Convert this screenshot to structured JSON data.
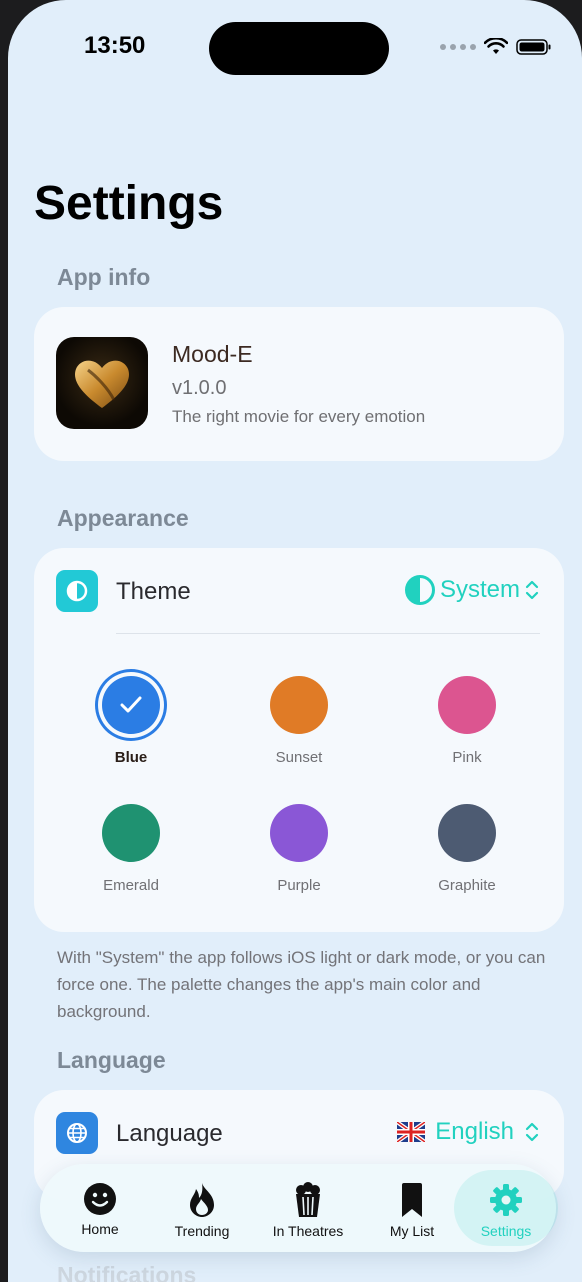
{
  "status": {
    "time": "13:50"
  },
  "page": {
    "title": "Settings"
  },
  "sections": {
    "app_info": "App info",
    "appearance": "Appearance",
    "language": "Language",
    "notifications": "Notifications"
  },
  "app": {
    "name": "Mood-E",
    "version": "v1.0.0",
    "tagline": "The right movie for every emotion"
  },
  "theme": {
    "label": "Theme",
    "value": "System",
    "accent": "#21d1bf",
    "icon": "half-circle-icon"
  },
  "palettes": [
    {
      "name": "Blue",
      "color": "#2b7de4",
      "selected": true
    },
    {
      "name": "Sunset",
      "color": "#e07b26",
      "selected": false
    },
    {
      "name": "Pink",
      "color": "#dc5590",
      "selected": false
    },
    {
      "name": "Emerald",
      "color": "#1f9271",
      "selected": false
    },
    {
      "name": "Purple",
      "color": "#8a57d6",
      "selected": false
    },
    {
      "name": "Graphite",
      "color": "#4d5b72",
      "selected": false
    }
  ],
  "appearance_note": "With \"System\" the app follows iOS light or dark mode, or you can force one. The palette changes the app's main color and background.",
  "language": {
    "label": "Language",
    "value": "English",
    "flag": "uk-flag-icon",
    "icon": "globe-icon"
  },
  "tabs": [
    {
      "label": "Home",
      "icon": "smiley-icon",
      "active": false
    },
    {
      "label": "Trending",
      "icon": "flame-icon",
      "active": false
    },
    {
      "label": "In Theatres",
      "icon": "popcorn-icon",
      "active": false
    },
    {
      "label": "My List",
      "icon": "bookmark-icon",
      "active": false
    },
    {
      "label": "Settings",
      "icon": "gear-icon",
      "active": true
    }
  ]
}
